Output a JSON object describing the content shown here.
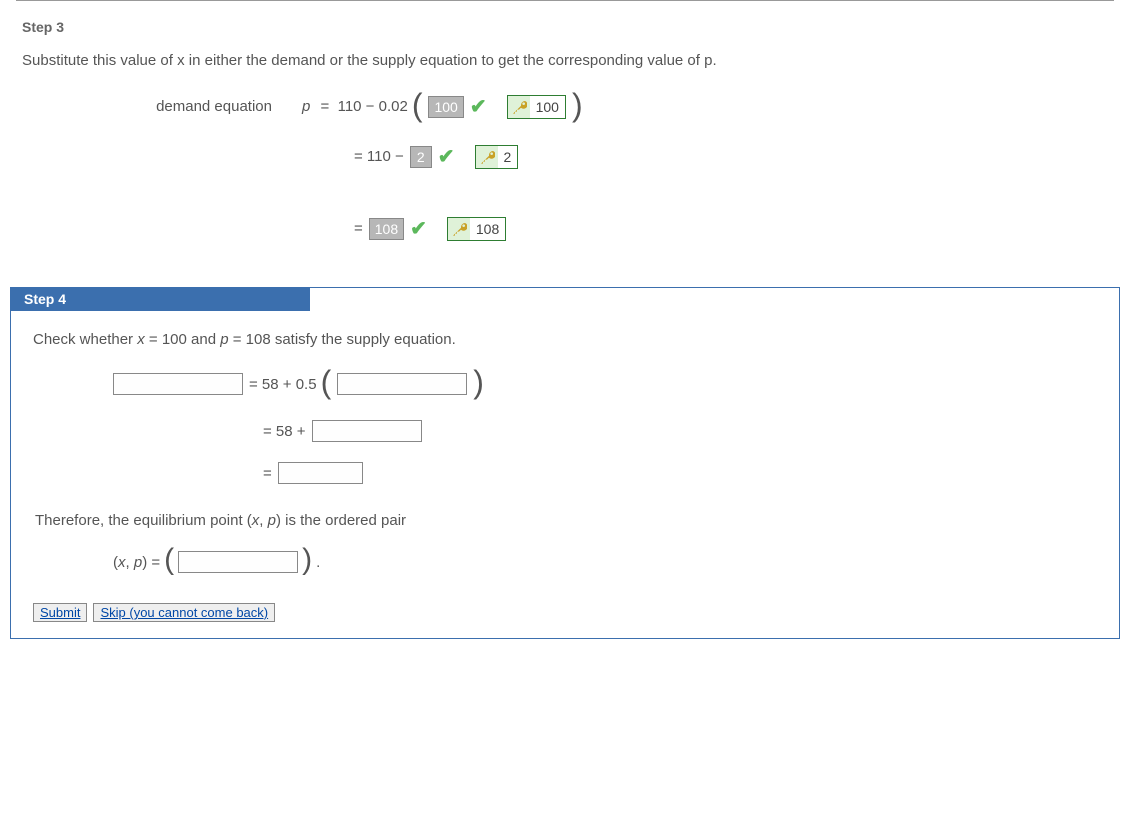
{
  "step3": {
    "heading": "Step 3",
    "text": "Substitute this value of x in either the demand or the supply equation to get the corresponding value of p.",
    "label": "demand equation",
    "p_eq_prefix": "p  =  110 − 0.02",
    "answer1": "100",
    "key1": "100",
    "line2_prefix": "=  110 −",
    "answer2": "2",
    "key2": "2",
    "line3_prefix": "=",
    "answer3": "108",
    "key3": "108"
  },
  "step4": {
    "heading": "Step 4",
    "intro_a": "Check whether ",
    "intro_b": "x",
    "intro_c": " = 100 and ",
    "intro_d": "p",
    "intro_e": " = 108 satisfy the supply equation.",
    "eq1_mid": " =  58 + 0.5",
    "eq2_prefix": "=  58 +",
    "eq3_prefix": "=",
    "therefore_a": "Therefore, the equilibrium point  (",
    "therefore_b": "x",
    "therefore_c": ", ",
    "therefore_d": "p",
    "therefore_e": ")  is the ordered pair",
    "pair_lhs_a": "(",
    "pair_lhs_b": "x",
    "pair_lhs_c": ", ",
    "pair_lhs_d": "p",
    "pair_lhs_e": ") = ",
    "period": ".",
    "submit_label": "Submit",
    "skip_label": "Skip (you cannot come back)"
  }
}
